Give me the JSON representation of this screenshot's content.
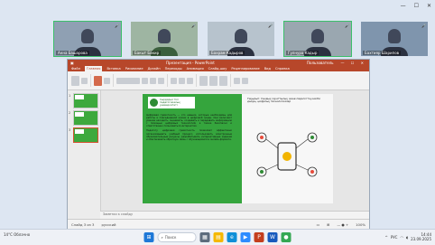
{
  "window": {
    "minimize": "—",
    "maximize": "☐",
    "close": "✕"
  },
  "participants": [
    {
      "name": "Анна Башарова",
      "mic": "🎤"
    },
    {
      "name": "Бакыт Бакир",
      "mic": "🎤"
    },
    {
      "name": "Бахрам Кадыров",
      "mic": "🎤"
    },
    {
      "name": "Гулнура Кадыр",
      "mic": "🎤"
    },
    {
      "name": "Бахтияр Шарипов",
      "mic": "🎤"
    }
  ],
  "ppt": {
    "title": "Презентация - PowerPoint",
    "user": "Пользователь",
    "ctrls": "— ☐ ✕",
    "tabs": [
      "Файл",
      "Главная",
      "Вставка",
      "Рисование",
      "Дизайн",
      "Переходы",
      "Анимация",
      "Слайд-шоу",
      "Рецензирование",
      "Вид",
      "Справка"
    ],
    "active_tab": 1
  },
  "thumbnails": [
    {
      "num": "1"
    },
    {
      "num": "2"
    },
    {
      "num": "3"
    }
  ],
  "slide": {
    "logo_text": "Сырдарья тілі\nпедагогикалық\nуниверситеті",
    "paragraph1": "Цифровая грамотность — это навыки, которые необходимы для работы и повседневной жизни в цифровой среде. Они включают умение находить, оценивать, создавать и передавать информацию с помощью цифровых технологий, а также безопасно и ответственно пользоваться интернетом.",
    "paragraph2": "Педагогу цифровая грамотность позволяет эффективно организовывать учебный процесс, использовать электронные образовательные ресурсы, разрабатывать интерактивные задания и обеспечивать обратную связь с обучающимися в онлайн-формате.",
    "caption": "Тақырып: Сандық сауаттылық және педагогтің кәсіби дамуы, цифрлық технологиялар"
  },
  "notes_placeholder": "Заметки к слайду",
  "status": {
    "slide_counter": "Слайд 3 из 3",
    "language": "русский",
    "zoom": "100%"
  },
  "taskbar": {
    "weather": "14°C Облачно",
    "search_placeholder": "Поиск",
    "lang": "РУС",
    "time": "14:44",
    "date": "23.09.2025"
  }
}
